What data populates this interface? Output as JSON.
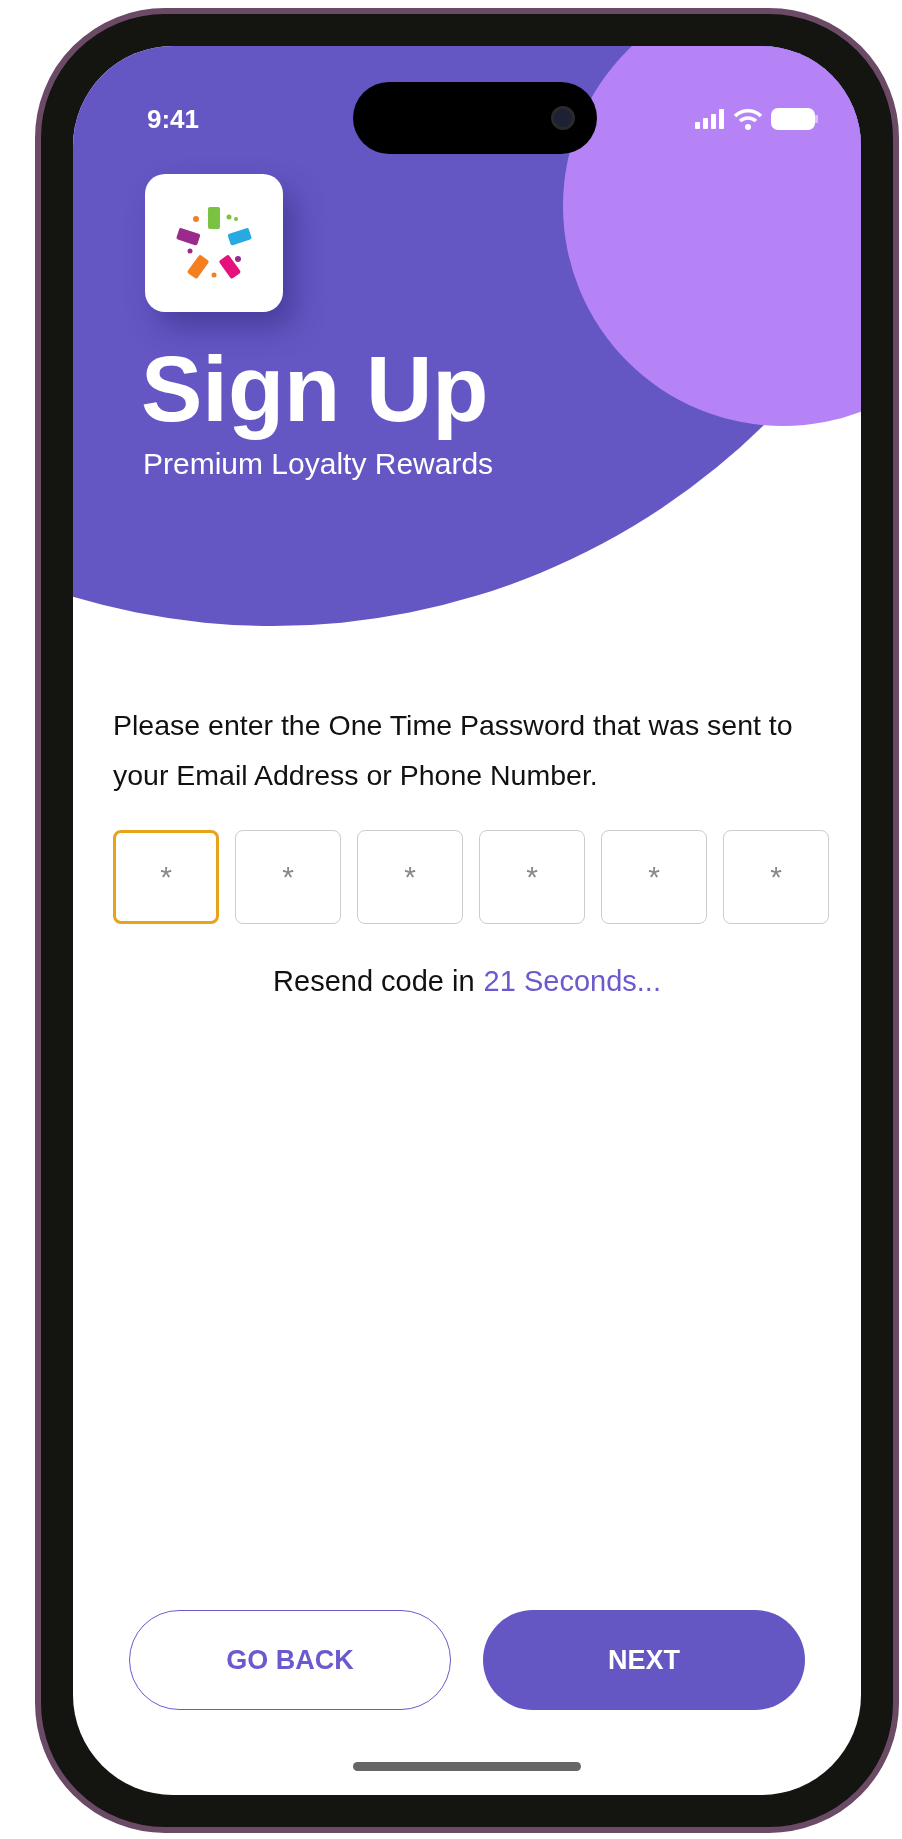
{
  "status_bar": {
    "time": "9:41"
  },
  "header": {
    "title": "Sign Up",
    "subtitle": "Premium Loyalty Rewards"
  },
  "instructions": "Please enter the One Time Password that was sent to your Email Address or Phone Number.",
  "otp_fields": [
    {
      "placeholder": "*",
      "selected": true
    },
    {
      "placeholder": "*",
      "selected": false
    },
    {
      "placeholder": "*",
      "selected": false
    },
    {
      "placeholder": "*",
      "selected": false
    },
    {
      "placeholder": "*",
      "selected": false
    },
    {
      "placeholder": "*",
      "selected": false
    }
  ],
  "resend": {
    "label": "Resend code in",
    "countdown": "21 Seconds..."
  },
  "buttons": [
    {
      "label": "GO BACK",
      "kind": "outline"
    },
    {
      "label": "NEXT",
      "kind": "filled"
    }
  ]
}
